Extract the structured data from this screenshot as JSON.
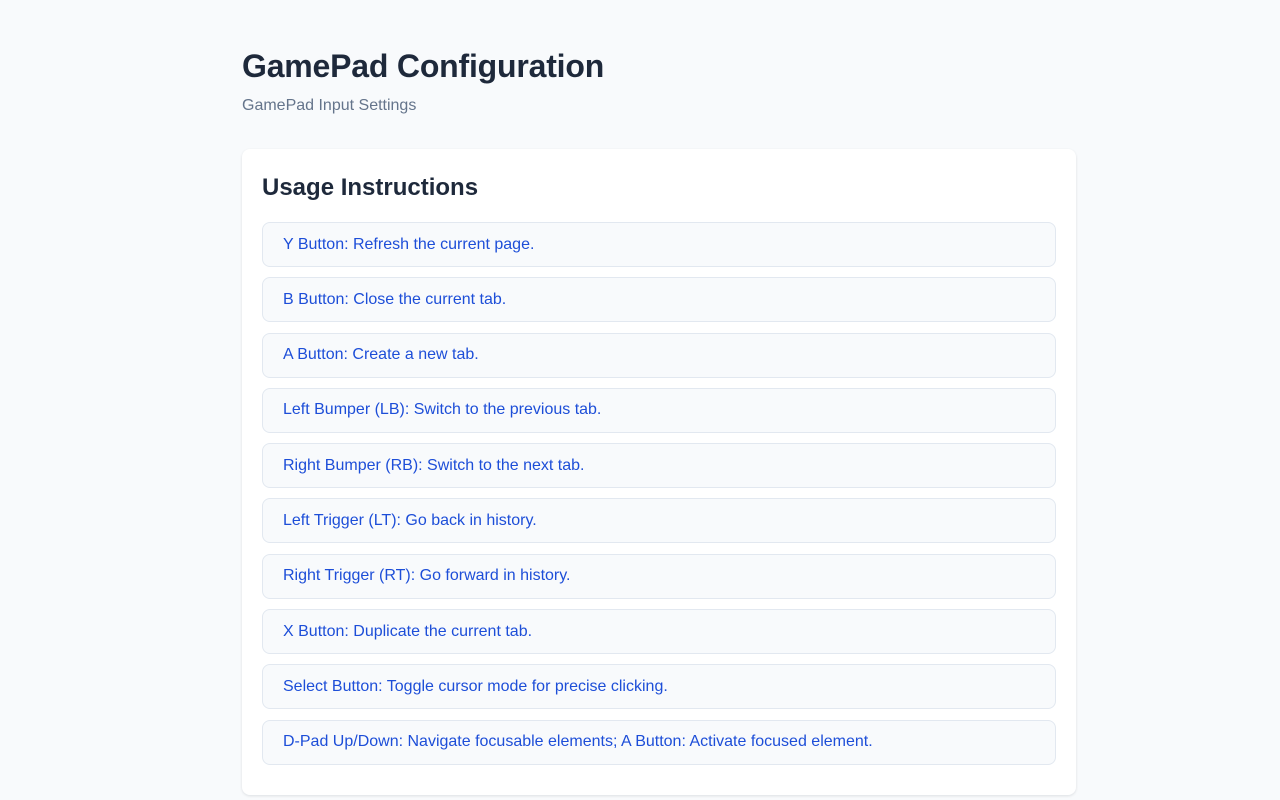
{
  "header": {
    "title": "GamePad Configuration",
    "subtitle": "GamePad Input Settings"
  },
  "instructions": {
    "title": "Usage Instructions",
    "items": [
      "Y Button: Refresh the current page.",
      "B Button: Close the current tab.",
      "A Button: Create a new tab.",
      "Left Bumper (LB): Switch to the previous tab.",
      "Right Bumper (RB): Switch to the next tab.",
      "Left Trigger (LT): Go back in history.",
      "Right Trigger (RT): Go forward in history.",
      "X Button: Duplicate the current tab.",
      "Select Button: Toggle cursor mode for precise clicking.",
      "D-Pad Up/Down: Navigate focusable elements; A Button: Activate focused element."
    ]
  },
  "colors": {
    "background": "#f8fafc",
    "heading": "#1e293b",
    "subtitle": "#64748b",
    "item_text": "#1d4ed8",
    "item_border": "#e2e8f0"
  }
}
